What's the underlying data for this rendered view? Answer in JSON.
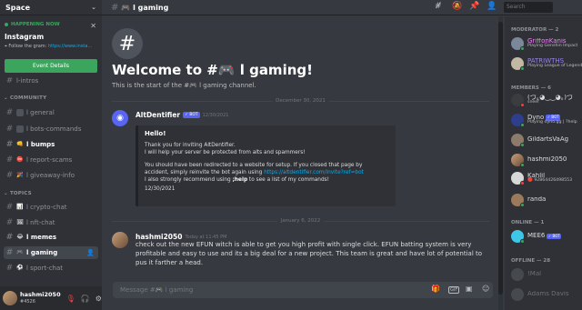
{
  "server": {
    "name": "Space"
  },
  "event": {
    "status": "HAPPENING NOW",
    "title": "Instagram",
    "description": "Follow the gram: ",
    "link": "https://www.insta...",
    "button_label": "Event Details"
  },
  "sidebar": {
    "hidden_channel": "l-intros",
    "categories": {
      "community": "COMMUNITY",
      "topics": "TOPICS"
    },
    "community": [
      {
        "label": "l general",
        "emoji": "",
        "bold": false
      },
      {
        "label": "l bots-commands",
        "emoji": "",
        "bold": false
      },
      {
        "label": "l bumps",
        "emoji": "👊",
        "bold": true
      },
      {
        "label": "l report-scams",
        "emoji": "⛔",
        "bold": false
      },
      {
        "label": "l giveaway-info",
        "emoji": "🎉",
        "bold": false
      }
    ],
    "topics": [
      {
        "label": "l crypto-chat",
        "emoji": "📊",
        "bold": false
      },
      {
        "label": "l nft-chat",
        "emoji": "🖼",
        "bold": false
      },
      {
        "label": "l memes",
        "emoji": "😂",
        "bold": true
      },
      {
        "label": "l gaming",
        "emoji": "🎮",
        "bold": true,
        "active": true
      },
      {
        "label": "l sport-chat",
        "emoji": "⚽",
        "bold": false
      }
    ]
  },
  "user": {
    "name": "hashmi2050",
    "tag": "#4526"
  },
  "channel": {
    "title": "🎮 l gaming"
  },
  "search": {
    "placeholder": "Search"
  },
  "welcome": {
    "title": "Welcome to #🎮 l gaming!",
    "subtitle": "This is the start of the #🎮 l gaming channel."
  },
  "dividers": [
    "December 30, 2021",
    "January 6, 2022"
  ],
  "messages": [
    {
      "author": "AltDentifier",
      "bot_badge": "✓ BOT",
      "time": "12/30/2021",
      "embed": {
        "title": "Hello!",
        "lines": [
          "Thank you for inviting AltDentifier.",
          "I will help your server be protected from alts and spammers!"
        ],
        "lines2": [
          "You should have been redirected to a website for setup. If you closed that page by",
          "accident, simply reinvite the bot again using "
        ],
        "link": "https://altdentifier.com/invite?ref=bot",
        "line3_a": "I also strongly recommend using ",
        "line3_b": ";help",
        "line3_c": " to see a list of my commands!",
        "date": "12/30/2021"
      }
    },
    {
      "author": "hashmi2050",
      "time": "Today at 11:45 PM",
      "body": "check out the new EFUN witch is able to get you high profit with single click. EFUN batting system is very profitable and easy to use and its a big deal for a new project. This team is great and have lot of potential to pus it farther a head."
    }
  ],
  "composer": {
    "placeholder": "Message #🎮 l gaming"
  },
  "members": {
    "categories": {
      "moderator": "MODERATOR — 2",
      "members": "MEMBERS — 6",
      "online": "ONLINE — 1",
      "offline": "OFFLINE — 28"
    },
    "moderators": [
      {
        "name": "GriffonKanis",
        "activity": "Playing Genshin Impact",
        "color": "#f47fff"
      },
      {
        "name": "PATRIWTHS",
        "activity": "Playing League of Legends",
        "color": "#9b84ee"
      }
    ],
    "members": [
      {
        "name": "(づ｡◕‿‿◕｡)づ",
        "activity": "sneef"
      },
      {
        "name": "Dyno",
        "bot": "✓ BOT",
        "activity": "Playing dyno.gg | ?help"
      },
      {
        "name": "GildartsVaAg",
        "activity": ""
      },
      {
        "name": "hashmi2050",
        "activity": ""
      },
      {
        "name": "Kahlil",
        "activity": "🔴 92864426498553"
      },
      {
        "name": "randa",
        "activity": ""
      }
    ],
    "online": [
      {
        "name": "MEE6",
        "bot": "✓ BOT"
      }
    ],
    "offline": [
      {
        "name": "!Mal"
      },
      {
        "name": "Adams Davis"
      }
    ]
  },
  "colors": {
    "accent": "#5865f2",
    "green": "#3ba55d",
    "link": "#00aff4",
    "danger": "#ed4245"
  }
}
